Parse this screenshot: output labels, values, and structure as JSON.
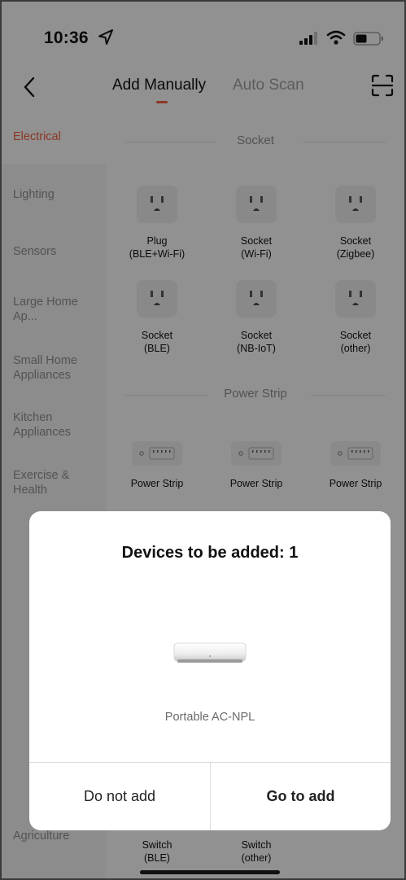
{
  "status_bar": {
    "time": "10:36"
  },
  "nav": {
    "tab_manual": "Add Manually",
    "tab_auto": "Auto Scan"
  },
  "sidebar": {
    "items": [
      {
        "label": "Electrical",
        "active": true
      },
      {
        "label": "Lighting"
      },
      {
        "label": "Sensors"
      },
      {
        "label": "Large Home Ap..."
      },
      {
        "label": "Small Home Appliances"
      },
      {
        "label": "Kitchen Appliances"
      },
      {
        "label": "Exercise & Health"
      },
      {
        "label": "Agriculture"
      }
    ]
  },
  "content": {
    "socket_section": {
      "title": "Socket",
      "devices": [
        {
          "line1": "Plug",
          "line2": "(BLE+Wi-Fi)"
        },
        {
          "line1": "Socket",
          "line2": "(Wi-Fi)"
        },
        {
          "line1": "Socket",
          "line2": "(Zigbee)"
        },
        {
          "line1": "Socket",
          "line2": "(BLE)"
        },
        {
          "line1": "Socket",
          "line2": "(NB-IoT)"
        },
        {
          "line1": "Socket",
          "line2": "(other)"
        }
      ]
    },
    "strip_section": {
      "title": "Power Strip",
      "devices": [
        {
          "line1": "Power Strip"
        },
        {
          "line1": "Power Strip"
        },
        {
          "line1": "Power Strip"
        }
      ]
    },
    "switch_row": [
      {
        "line1": "Switch",
        "line2": "(BLE)"
      },
      {
        "line1": "Switch",
        "line2": "(other)"
      }
    ]
  },
  "dialog": {
    "title": "Devices to be added: 1",
    "device_name": "Portable AC-NPL",
    "btn_cancel": "Do not add",
    "btn_confirm": "Go to add"
  },
  "colors": {
    "accent": "#e85c3e"
  }
}
